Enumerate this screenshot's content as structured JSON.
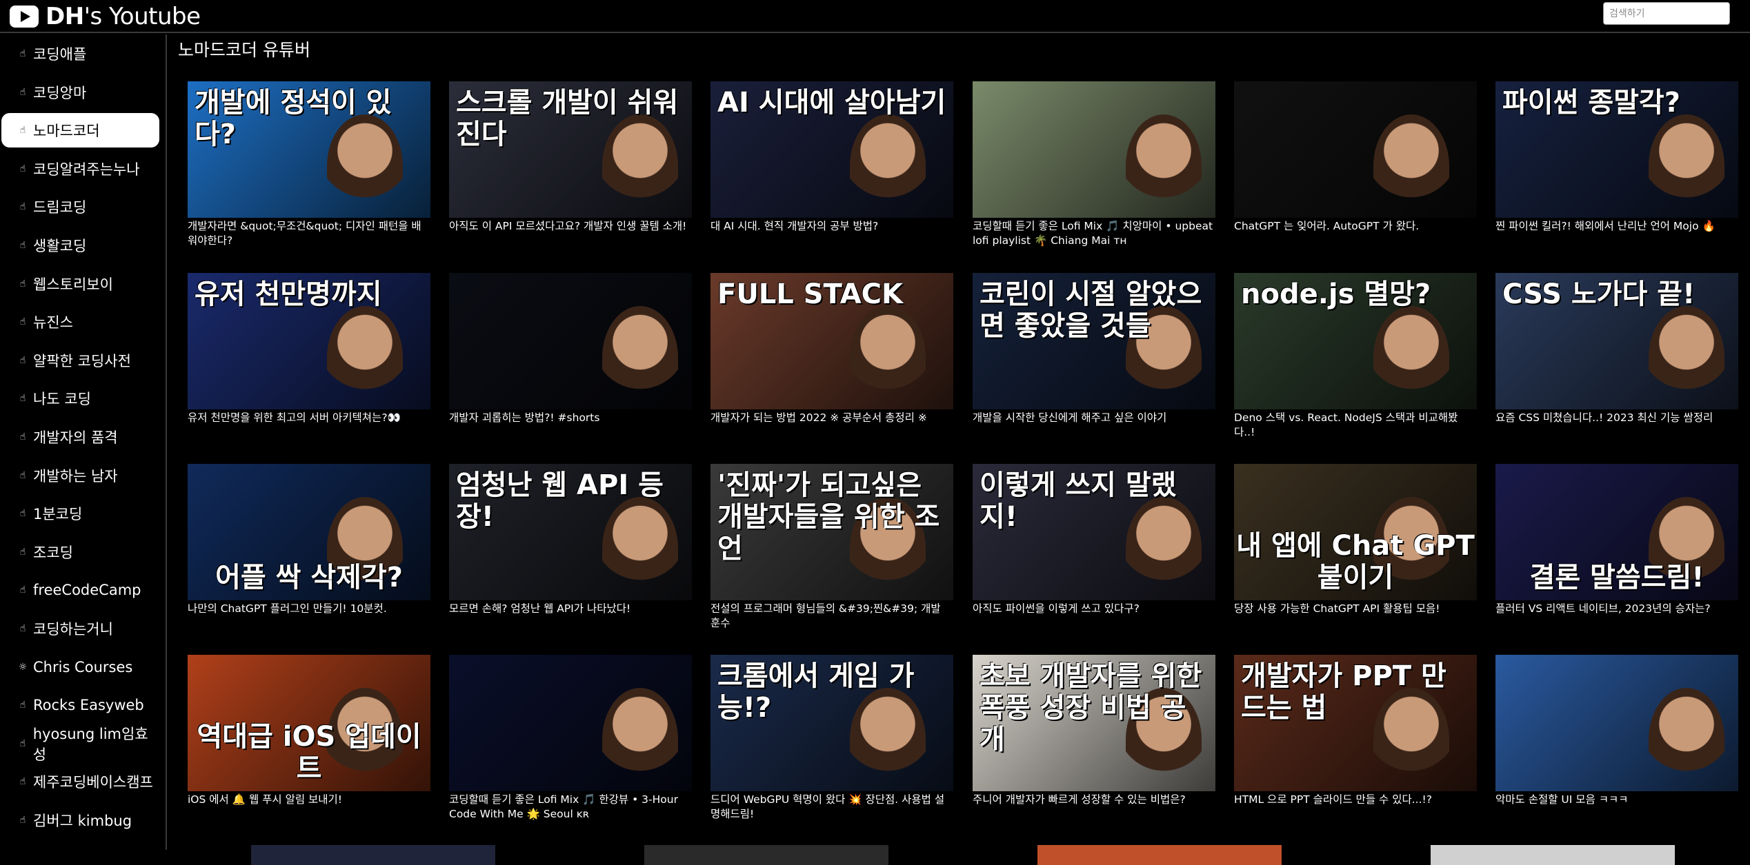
{
  "header": {
    "logo_bold": "DH",
    "logo_rest": "'s Youtube",
    "search_placeholder": "검색하기"
  },
  "sidebar": {
    "items": [
      {
        "label": "코딩애플",
        "icon": "hand-icon"
      },
      {
        "label": "코딩앙마",
        "icon": "hand-icon"
      },
      {
        "label": "노마드코더",
        "icon": "hand-icon",
        "active": true
      },
      {
        "label": "코딩알려주는누나",
        "icon": "hand-icon"
      },
      {
        "label": "드림코딩",
        "icon": "hand-icon"
      },
      {
        "label": "생활코딩",
        "icon": "hand-icon"
      },
      {
        "label": "웹스토리보이",
        "icon": "hand-icon"
      },
      {
        "label": "뉴진스",
        "icon": "hand-icon"
      },
      {
        "label": "얄팍한 코딩사전",
        "icon": "hand-icon"
      },
      {
        "label": "나도 코딩",
        "icon": "hand-icon"
      },
      {
        "label": "개발자의 품격",
        "icon": "hand-icon"
      },
      {
        "label": "개발하는 남자",
        "icon": "hand-icon"
      },
      {
        "label": "1분코딩",
        "icon": "hand-icon"
      },
      {
        "label": "조코딩",
        "icon": "hand-icon"
      },
      {
        "label": "freeCodeCamp",
        "icon": "hand-icon"
      },
      {
        "label": "코딩하는거니",
        "icon": "hand-icon"
      },
      {
        "label": "Chris Courses",
        "icon": "sun-icon"
      },
      {
        "label": "Rocks Easyweb",
        "icon": "hand-icon"
      },
      {
        "label": "hyosung lim임효성",
        "icon": "hand-icon"
      },
      {
        "label": "제주코딩베이스캠프",
        "icon": "hand-icon"
      },
      {
        "label": "김버그 kimbug",
        "icon": "hand-icon"
      }
    ]
  },
  "main": {
    "title": "노마드코더 유튜버",
    "videos": [
      {
        "title": "개발자라면 &quot;무조건&quot; 디자인 패턴을 배워야한다?",
        "thumb_text": "개발에 정석이 있다?",
        "bg": "#1d6fc4"
      },
      {
        "title": "아직도 이 API 모르셨다고요? 개발자 인생 꿀템 소개!",
        "thumb_text": "스크롤 개발이 쉬워진다",
        "bg": "#2b2d3a"
      },
      {
        "title": "대 AI 시대. 현직 개발자의 공부 방법?",
        "thumb_text": "AI 시대에 살아남기",
        "bg": "#1a1f3a"
      },
      {
        "title": "코딩할때 듣기 좋은 Lofi Mix 🎵 치앙마이 • upbeat lofi playlist 🌴 Chiang Mai ᴛʜ",
        "thumb_text": "",
        "bg": "#7a8a6a"
      },
      {
        "title": "ChatGPT 는 잊어라. AutoGPT 가 왔다.",
        "thumb_text": "",
        "bg": "#111111"
      },
      {
        "title": "찐 파이썬 킬러?! 해외에서 난리난 언어 Mojo 🔥",
        "thumb_text": "파이썬 종말각?",
        "bg": "#16213f"
      },
      {
        "title": "유저 천만명을 위한 최고의 서버 아키텍쳐는?👀",
        "thumb_text": "유저 천만명까지",
        "bg": "#1a2a6c"
      },
      {
        "title": "개발자 괴롭히는 방법?! #shorts",
        "thumb_text": "",
        "bg": "#0b0d14"
      },
      {
        "title": "개발자가 되는 방법 2022 ※ 공부순서 총정리 ※",
        "thumb_text": "FULL STACK",
        "bg": "#6a3a2a"
      },
      {
        "title": "개발을 시작한 당신에게 해주고 싶은 이야기",
        "thumb_text": "코린이 시절 알았으면 좋았을 것들",
        "bg": "#15213a"
      },
      {
        "title": "Deno 스택 vs. React. NodeJS 스택과 비교해봤다..!",
        "thumb_text": "node.js 멸망?",
        "bg": "#2a3a2a"
      },
      {
        "title": "요즘 CSS 미쳤습니다..! 2023 최신 기능 쌈정리",
        "thumb_text": "CSS 노가다 끝!",
        "bg": "#2a3a5a"
      },
      {
        "title": "나만의 ChatGPT 플러그인 만들기! 10분컷.",
        "thumb_text": "어플 싹 삭제각?",
        "bg": "#102a5a"
      },
      {
        "title": "모르면 손해? 엄청난 웹 API가 나타났다!",
        "thumb_text": "엄청난 웹 API 등장!",
        "bg": "#1f2128"
      },
      {
        "title": "전설의 프로그래머 형님들의 &#39;찐&#39; 개발 훈수",
        "thumb_text": "'진짜'가 되고싶은 개발자들을 위한 조언",
        "bg": "#3a3a3a"
      },
      {
        "title": "아직도 파이썬을 이렇게 쓰고 있다구?",
        "thumb_text": "이렇게 쓰지 말랬지!",
        "bg": "#2a2a3a"
      },
      {
        "title": "당장 사용 가능한 ChatGPT API 활용팁 모음!",
        "thumb_text": "내 앱에 Chat GPT 붙이기",
        "bg": "#3a3020"
      },
      {
        "title": "플러터 VS 리액트 네이티브, 2023년의 승자는?",
        "thumb_text": "결론 말씀드림!",
        "bg": "#1a1a4a"
      },
      {
        "title": "iOS 에서 🔔 웹 푸시 알림 보내기!",
        "thumb_text": "역대급 iOS 업데이트",
        "bg": "#b0401a"
      },
      {
        "title": "코딩할때 듣기 좋은 Lofi Mix 🎵 한강뷰 • 3-Hour Code With Me 🌟 Seoul ᴋʀ",
        "thumb_text": "",
        "bg": "#0a0f2a"
      },
      {
        "title": "드디어 WebGPU 혁명이 왔다 💥 장단점. 사용법 설명해드림!",
        "thumb_text": "크롬에서 게임 가능!?",
        "bg": "#1a2a4a"
      },
      {
        "title": "주니어 개발자가 빠르게 성장할 수 있는 비법은?",
        "thumb_text": "초보 개발자를 위한 폭풍 성장 비법 공개",
        "bg": "#d8d4cc"
      },
      {
        "title": "HTML 으로 PPT 슬라이드 만들 수 있다...!?",
        "thumb_text": "개발자가 PPT 만드는 법",
        "bg": "#5a2a1a"
      },
      {
        "title": "악마도 손절할 UI 모음 ㅋㅋㅋ",
        "thumb_text": "",
        "bg": "#2a5aa0"
      }
    ]
  }
}
